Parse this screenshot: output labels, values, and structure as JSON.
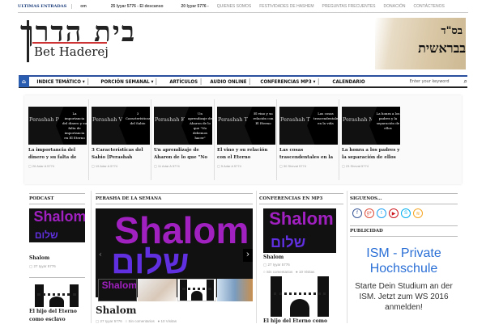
{
  "topbar": {
    "label": "ULTIMAS ENTRADAS",
    "ticker1": "om",
    "ticker2": "25 Iyyar 5776 - El descanso",
    "ticker3": "20 Iyyar 5776 -",
    "links": [
      "QUIENES SOMOS",
      "FESTIVIDADES DE HASHEM",
      "PREGUNTAS FRECUENTES",
      "DONACIÓN",
      "CONTÁCTENOS"
    ]
  },
  "logo": {
    "hebrew": "בית הדרך",
    "name": "Bet Haderej"
  },
  "banner": {
    "text1": "בס\"ד",
    "text2": "בבראשית"
  },
  "nav": {
    "items": [
      "INDICE TEMÁTICO ▾",
      "PORCIÓN SEMANAL ▾",
      "ARTÍCULOS",
      "AUDIO ONLINE",
      "CONFERENCIAS MP3 ▾",
      "CALENDARIO"
    ],
    "search_placeholder": "Enter your keyword",
    "search_icon": "search-icon"
  },
  "slider": [
    {
      "img_left": "Perashah Pecude",
      "img_right": "La importancia del dinero y su falta de importancia en El Eterno",
      "title": "La importancia del dinero y su falta de",
      "date": "26 Adar A 5774"
    },
    {
      "img_left": "Perashah Vaiakhel",
      "img_right": "3 Características del Sabio",
      "title": "3 Características del Sabio [Perashah",
      "date": "19 Adar A 5774"
    },
    {
      "img_left": "Perashah Ki tisa",
      "img_right": "Un aprendizaje de Aharon de lo que \"No debemos hacer\"",
      "title": "Un aprendizaje de Aharon de lo que \"No",
      "date": "11 Adar A 5774"
    },
    {
      "img_left": "Perashah Tetzaveh",
      "img_right": "El vino y su relación con El Eterno",
      "title": "El vino y su relación con el Eterno",
      "date": "5 Adar A 5774"
    },
    {
      "img_left": "Perashah Terumah",
      "img_right": "Las cosas trascendentales en la vida",
      "title": "Las cosas trascendentales en la",
      "date": "30 Shevat 5774"
    },
    {
      "img_left": "Perashah Mishpatim",
      "img_right": "La honra a los padres y la separación de ellos",
      "title": "La honra a los padres y la separación de ellos",
      "date": "23 Shevat 5774"
    }
  ],
  "podcast": {
    "header": "PODCAST",
    "img_text": "Shalom",
    "img_heb": "שלום",
    "item1_title": "Shalom",
    "item1_date": "27 Iyyar 5776",
    "item2_title": "El hijo del Eterno como esclavo"
  },
  "perasha": {
    "header": "PERASHA DE LA SEMANA",
    "img_text": "Shalom",
    "img_heb": "שלום",
    "title": "Shalom",
    "date": "27 Iyyar 5776",
    "comments": "Sin comentarios",
    "visits": "10 Visitas"
  },
  "conferencias": {
    "header": "CONFERENCIAS EN MP3",
    "img_text": "Shalom",
    "img_heb": "שלום",
    "title": "Shalom",
    "date": "27 Iyyar 5776",
    "comments": "Sin comentarios",
    "visits": "10 Visitas",
    "item2_title": "El hijo del Eterno como"
  },
  "siguenos": {
    "header": "SIGUENOS...",
    "icons": [
      {
        "name": "facebook-icon",
        "glyph": "f",
        "color": "#3b5998"
      },
      {
        "name": "google-plus-icon",
        "glyph": "g+",
        "color": "#dd4b39"
      },
      {
        "name": "twitter-icon",
        "glyph": "t",
        "color": "#1da1f2"
      },
      {
        "name": "youtube-icon",
        "glyph": "▶",
        "color": "#cc181e"
      },
      {
        "name": "skype-icon",
        "glyph": "S",
        "color": "#00aff0"
      },
      {
        "name": "rss-icon",
        "glyph": "≋",
        "color": "#f5a623"
      }
    ]
  },
  "publicidad": {
    "header": "PUBLICIDAD",
    "ad_title": "ISM - Private Hochschule",
    "ad_text": "Starte Dein Studium an der ISM. Jetzt zum WS 2016 anmelden!"
  }
}
